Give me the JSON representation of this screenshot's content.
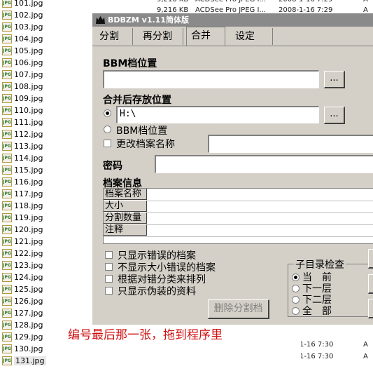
{
  "files": [
    "101.jpg",
    "102.jpg",
    "103.jpg",
    "104.jpg",
    "105.jpg",
    "106.jpg",
    "107.jpg",
    "108.jpg",
    "109.jpg",
    "110.jpg",
    "111.jpg",
    "112.jpg",
    "113.jpg",
    "114.jpg",
    "115.jpg",
    "116.jpg",
    "117.jpg",
    "118.jpg",
    "119.jpg",
    "120.jpg",
    "121.jpg",
    "122.jpg",
    "123.jpg",
    "124.jpg",
    "125.jpg",
    "126.jpg",
    "127.jpg",
    "128.jpg",
    "129.jpg",
    "130.jpg",
    "131.jpg"
  ],
  "file_icon_text": "JPG",
  "background_rows": [
    {
      "size": "9,216 KB",
      "type": "ACDSee Pro JPEG I...",
      "date": "2008-1-16 7:29",
      "attr": "A"
    },
    {
      "size": "9,216 KB",
      "type": "ACDSee Pro JPEG I...",
      "date": "2008-1-16 7:29",
      "attr": "A"
    }
  ],
  "background_bottom_rows": [
    {
      "date": "1-16 7:30",
      "attr": "A"
    },
    {
      "date": "1-16 7:30",
      "attr": "A"
    }
  ],
  "window": {
    "title": "BDBZM v1.11简体版",
    "tabs": [
      "分割",
      "再分割",
      "合并",
      "设定"
    ],
    "active_tab": "合并"
  },
  "merge": {
    "bbm_label": "BBM档位置",
    "bbm_value": "",
    "browse_label": "...",
    "dest_label": "合并后存放位置",
    "dest_value": "H:\\",
    "radio_bbm_label": "BBM档位置",
    "rename_label": "更改档案名称",
    "rename_value": "",
    "password_label": "密码",
    "password_value": "",
    "info_label": "档案信息",
    "info_rows": [
      "档案名称",
      "大小",
      "分割数量",
      "注释"
    ],
    "options": [
      "只显示错误的档案",
      "不显示大小错误的档案",
      "根据对错分类来排列",
      "只显示伪装的资料"
    ],
    "delete_button": "删除分割档",
    "subdir_title": "子目录检查",
    "subdir_options": [
      "当　前",
      "下一层",
      "下二层",
      "全　部"
    ],
    "subdir_selected": "当　前"
  },
  "annotation": "编号最后那一张，拖到程序里"
}
